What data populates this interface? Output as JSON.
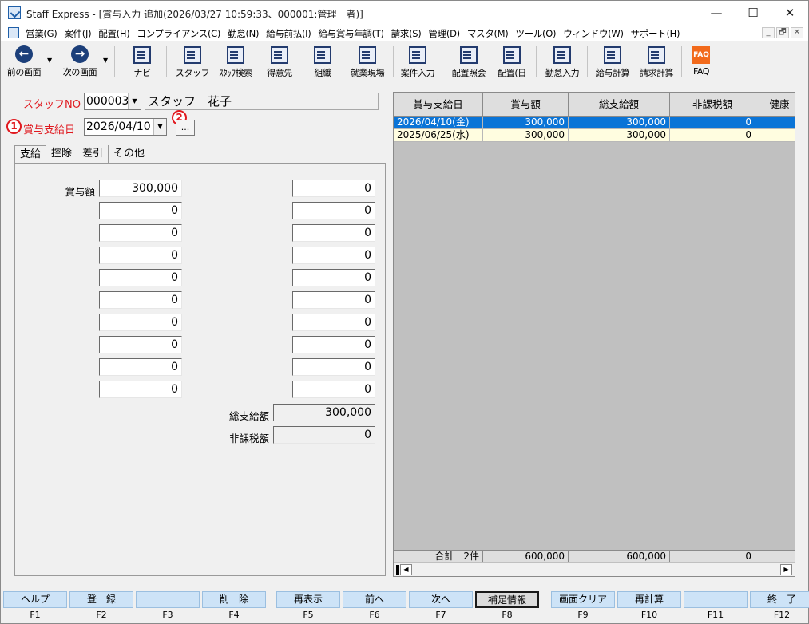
{
  "window": {
    "title": "Staff Express - [賞与入力 追加(2026/03/27 10:59:33、000001:管理　者)]",
    "minimize": "—",
    "maximize": "☐",
    "close": "✕"
  },
  "menu": {
    "items": [
      "営業(G)",
      "案件(J)",
      "配置(H)",
      "コンプライアンス(C)",
      "勤怠(N)",
      "給与前払(I)",
      "給与賞与年調(T)",
      "請求(S)",
      "管理(D)",
      "マスタ(M)",
      "ツール(O)",
      "ウィンドウ(W)",
      "サポート(H)"
    ],
    "mdi": [
      "_",
      "🗗",
      "✕"
    ]
  },
  "toolbar": {
    "prev": "前の画面",
    "next": "次の画面",
    "navi": "ナビ",
    "staff": "スタッフ",
    "staff_search": "ｽﾀｯﾌ検索",
    "client": "得意先",
    "org": "組織",
    "site": "就業現場",
    "case_input": "案件入力",
    "placement_inquiry": "配置照会",
    "placement_day": "配置(日",
    "attendance_input": "勤怠入力",
    "payroll_calc": "給与計算",
    "billing_calc": "請求計算",
    "faq": "FAQ",
    "faq_icon": "FAQ"
  },
  "form": {
    "staff_no_label": "スタッフNO",
    "staff_no": "000003",
    "staff_name": "スタッフ　花子",
    "badge1": "1",
    "badge2": "2",
    "bonus_date_label": "賞与支給日",
    "bonus_date": "2026/04/10",
    "ellipsis": "...",
    "tabs": [
      "支給",
      "控除",
      "差引",
      "その他"
    ],
    "bonus_label": "賞与額",
    "left_values": [
      "300,000",
      "0",
      "0",
      "0",
      "0",
      "0",
      "0",
      "0",
      "0",
      "0"
    ],
    "right_values": [
      "0",
      "0",
      "0",
      "0",
      "0",
      "0",
      "0",
      "0",
      "0",
      "0"
    ],
    "total_pay_label": "総支給額",
    "total_pay": "300,000",
    "nontax_label": "非課税額",
    "nontax": "0"
  },
  "grid": {
    "headers": [
      "賞与支給日",
      "賞与額",
      "総支給額",
      "非課税額",
      "健康"
    ],
    "rows": [
      [
        "2026/04/10(金)",
        "300,000",
        "300,000",
        "0",
        ""
      ],
      [
        "2025/06/25(水)",
        "300,000",
        "300,000",
        "0",
        ""
      ]
    ],
    "footer": [
      "合計　2件",
      "600,000",
      "600,000",
      "0",
      ""
    ],
    "scroll_left": "◀",
    "scroll_right": "▶"
  },
  "fkeys": [
    {
      "label": "ヘルプ",
      "key": "F1"
    },
    {
      "label": "登　録",
      "key": "F2"
    },
    {
      "label": "",
      "key": "F3"
    },
    {
      "label": "削　除",
      "key": "F4"
    },
    {
      "label": "再表示",
      "key": "F5"
    },
    {
      "label": "前へ",
      "key": "F6"
    },
    {
      "label": "次へ",
      "key": "F7"
    },
    {
      "label": "補足情報",
      "key": "F8"
    },
    {
      "label": "画面クリア",
      "key": "F9"
    },
    {
      "label": "再計算",
      "key": "F10"
    },
    {
      "label": "",
      "key": "F11"
    },
    {
      "label": "終　了",
      "key": "F12"
    }
  ],
  "colors": {
    "accent_red": "#e0191f",
    "selection_blue": "#0a74d7",
    "row_alt_yellow": "#fffde0",
    "fkey_blue": "#cde3f7"
  }
}
